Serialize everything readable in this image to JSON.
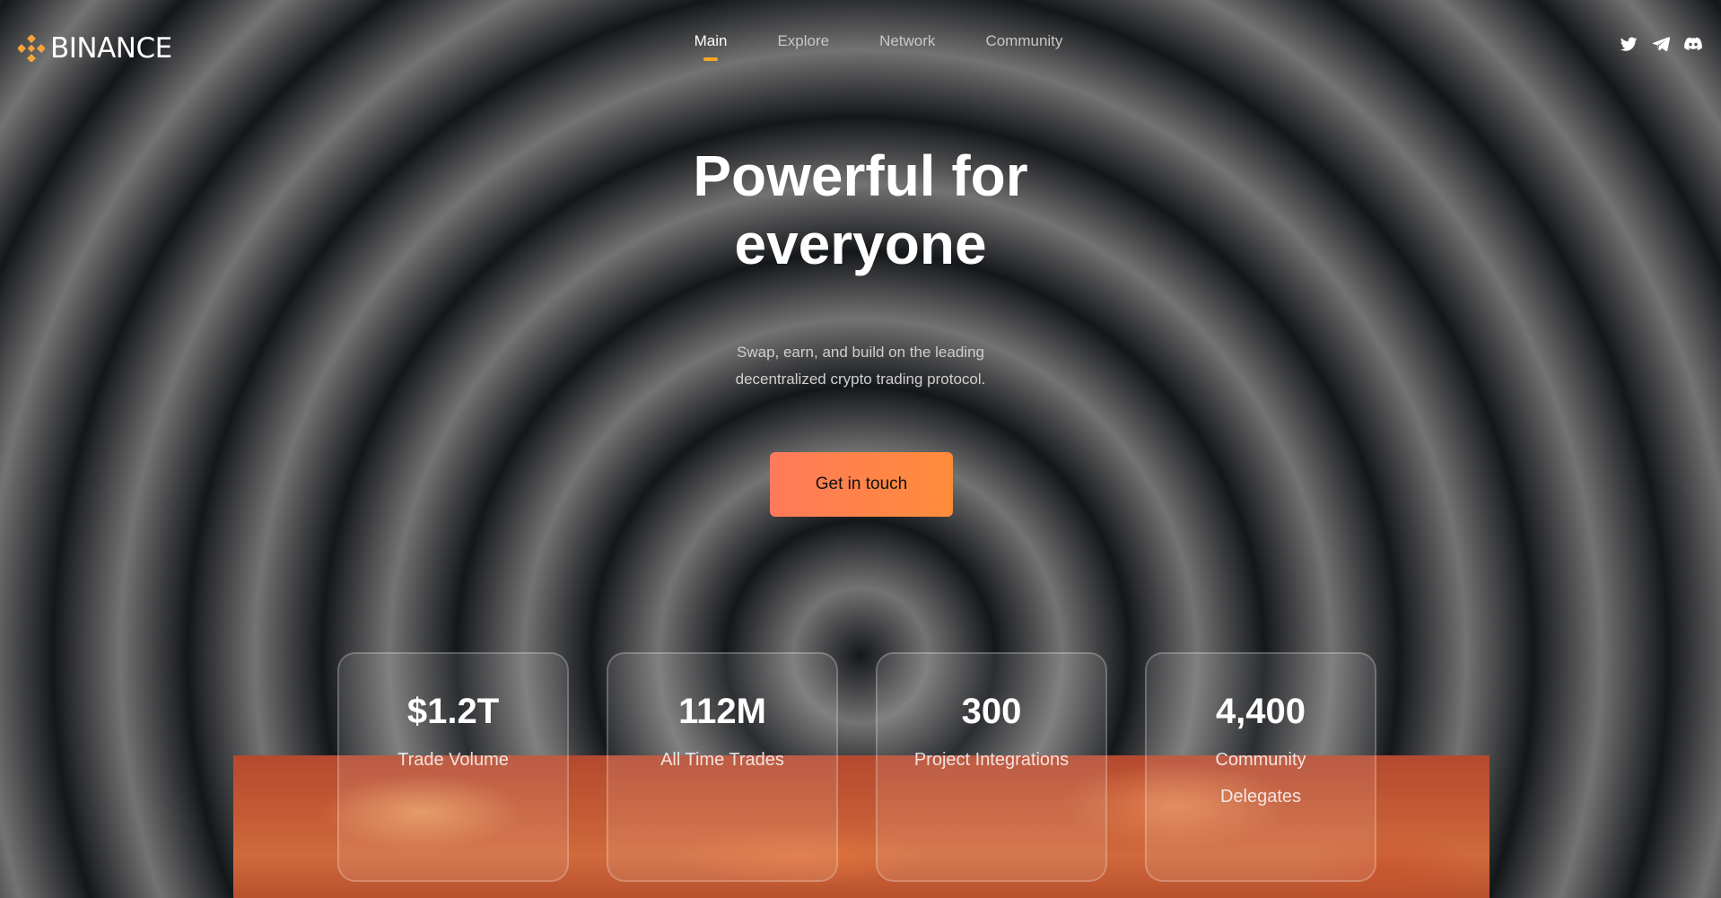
{
  "header": {
    "logo_text": "BINANCE",
    "nav": [
      {
        "label": "Main",
        "active": true
      },
      {
        "label": "Explore",
        "active": false
      },
      {
        "label": "Network",
        "active": false
      },
      {
        "label": "Community",
        "active": false
      }
    ],
    "socials": [
      "twitter-icon",
      "telegram-icon",
      "discord-icon"
    ]
  },
  "hero": {
    "title_line1": "Powerful for",
    "title_line2": "everyone",
    "subtitle_line1": "Swap, earn, and build on the leading",
    "subtitle_line2": "decentralized crypto trading protocol.",
    "cta_label": "Get in touch"
  },
  "stats": [
    {
      "value": "$1.2T",
      "label": "Trade Volume"
    },
    {
      "value": "112M",
      "label": "All Time Trades"
    },
    {
      "value": "300",
      "label": "Project Integrations"
    },
    {
      "value": "4,400",
      "label": "Community Delegates"
    }
  ],
  "colors": {
    "accent": "#f5a623",
    "cta_start": "#ff7a5a",
    "cta_end": "#ff8c3a",
    "logo": "#f3a43a"
  }
}
